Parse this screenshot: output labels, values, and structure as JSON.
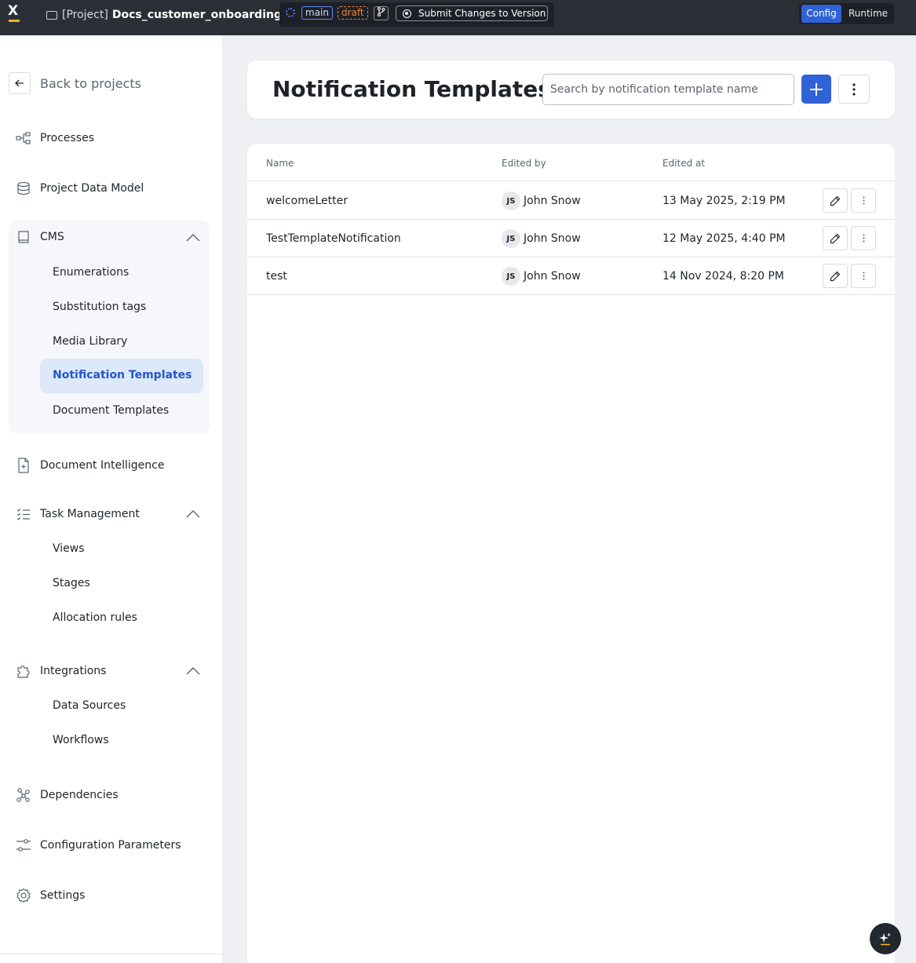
{
  "topbar": {
    "project_prefix": "[Project]",
    "project_name": "Docs_customer_onboarding",
    "branch": "main",
    "status": "draft",
    "submit_label": "Submit Changes to Version",
    "mode_config": "Config",
    "mode_runtime": "Runtime"
  },
  "sidebar": {
    "back_label": "Back to projects",
    "processes": "Processes",
    "data_model": "Project Data Model",
    "cms": {
      "label": "CMS",
      "items": [
        "Enumerations",
        "Substitution tags",
        "Media Library",
        "Notification Templates",
        "Document Templates"
      ],
      "active": "Notification Templates"
    },
    "document_intelligence": "Document Intelligence",
    "task_management": {
      "label": "Task Management",
      "items": [
        "Views",
        "Stages",
        "Allocation rules"
      ]
    },
    "integrations": {
      "label": "Integrations",
      "items": [
        "Data Sources",
        "Workflows"
      ]
    },
    "dependencies": "Dependencies",
    "config_params": "Configuration Parameters",
    "settings": "Settings"
  },
  "header": {
    "title": "Notification Templates",
    "search_placeholder": "Search by notification template name"
  },
  "table": {
    "columns": [
      "Name",
      "Edited by",
      "Edited at"
    ],
    "rows": [
      {
        "name": "welcomeLetter",
        "initials": "JS",
        "user": "John Snow",
        "date": "13 May 2025, 2:19 PM"
      },
      {
        "name": "TestTemplateNotification",
        "initials": "JS",
        "user": "John Snow",
        "date": "12 May 2025, 4:40 PM"
      },
      {
        "name": "test",
        "initials": "JS",
        "user": "John Snow",
        "date": "14 Nov 2024, 8:20 PM"
      }
    ]
  },
  "colors": {
    "accent": "#2f62d6",
    "active_bg": "#dde8fb",
    "topbar": "#2b2f36",
    "draft": "#e8833a"
  }
}
